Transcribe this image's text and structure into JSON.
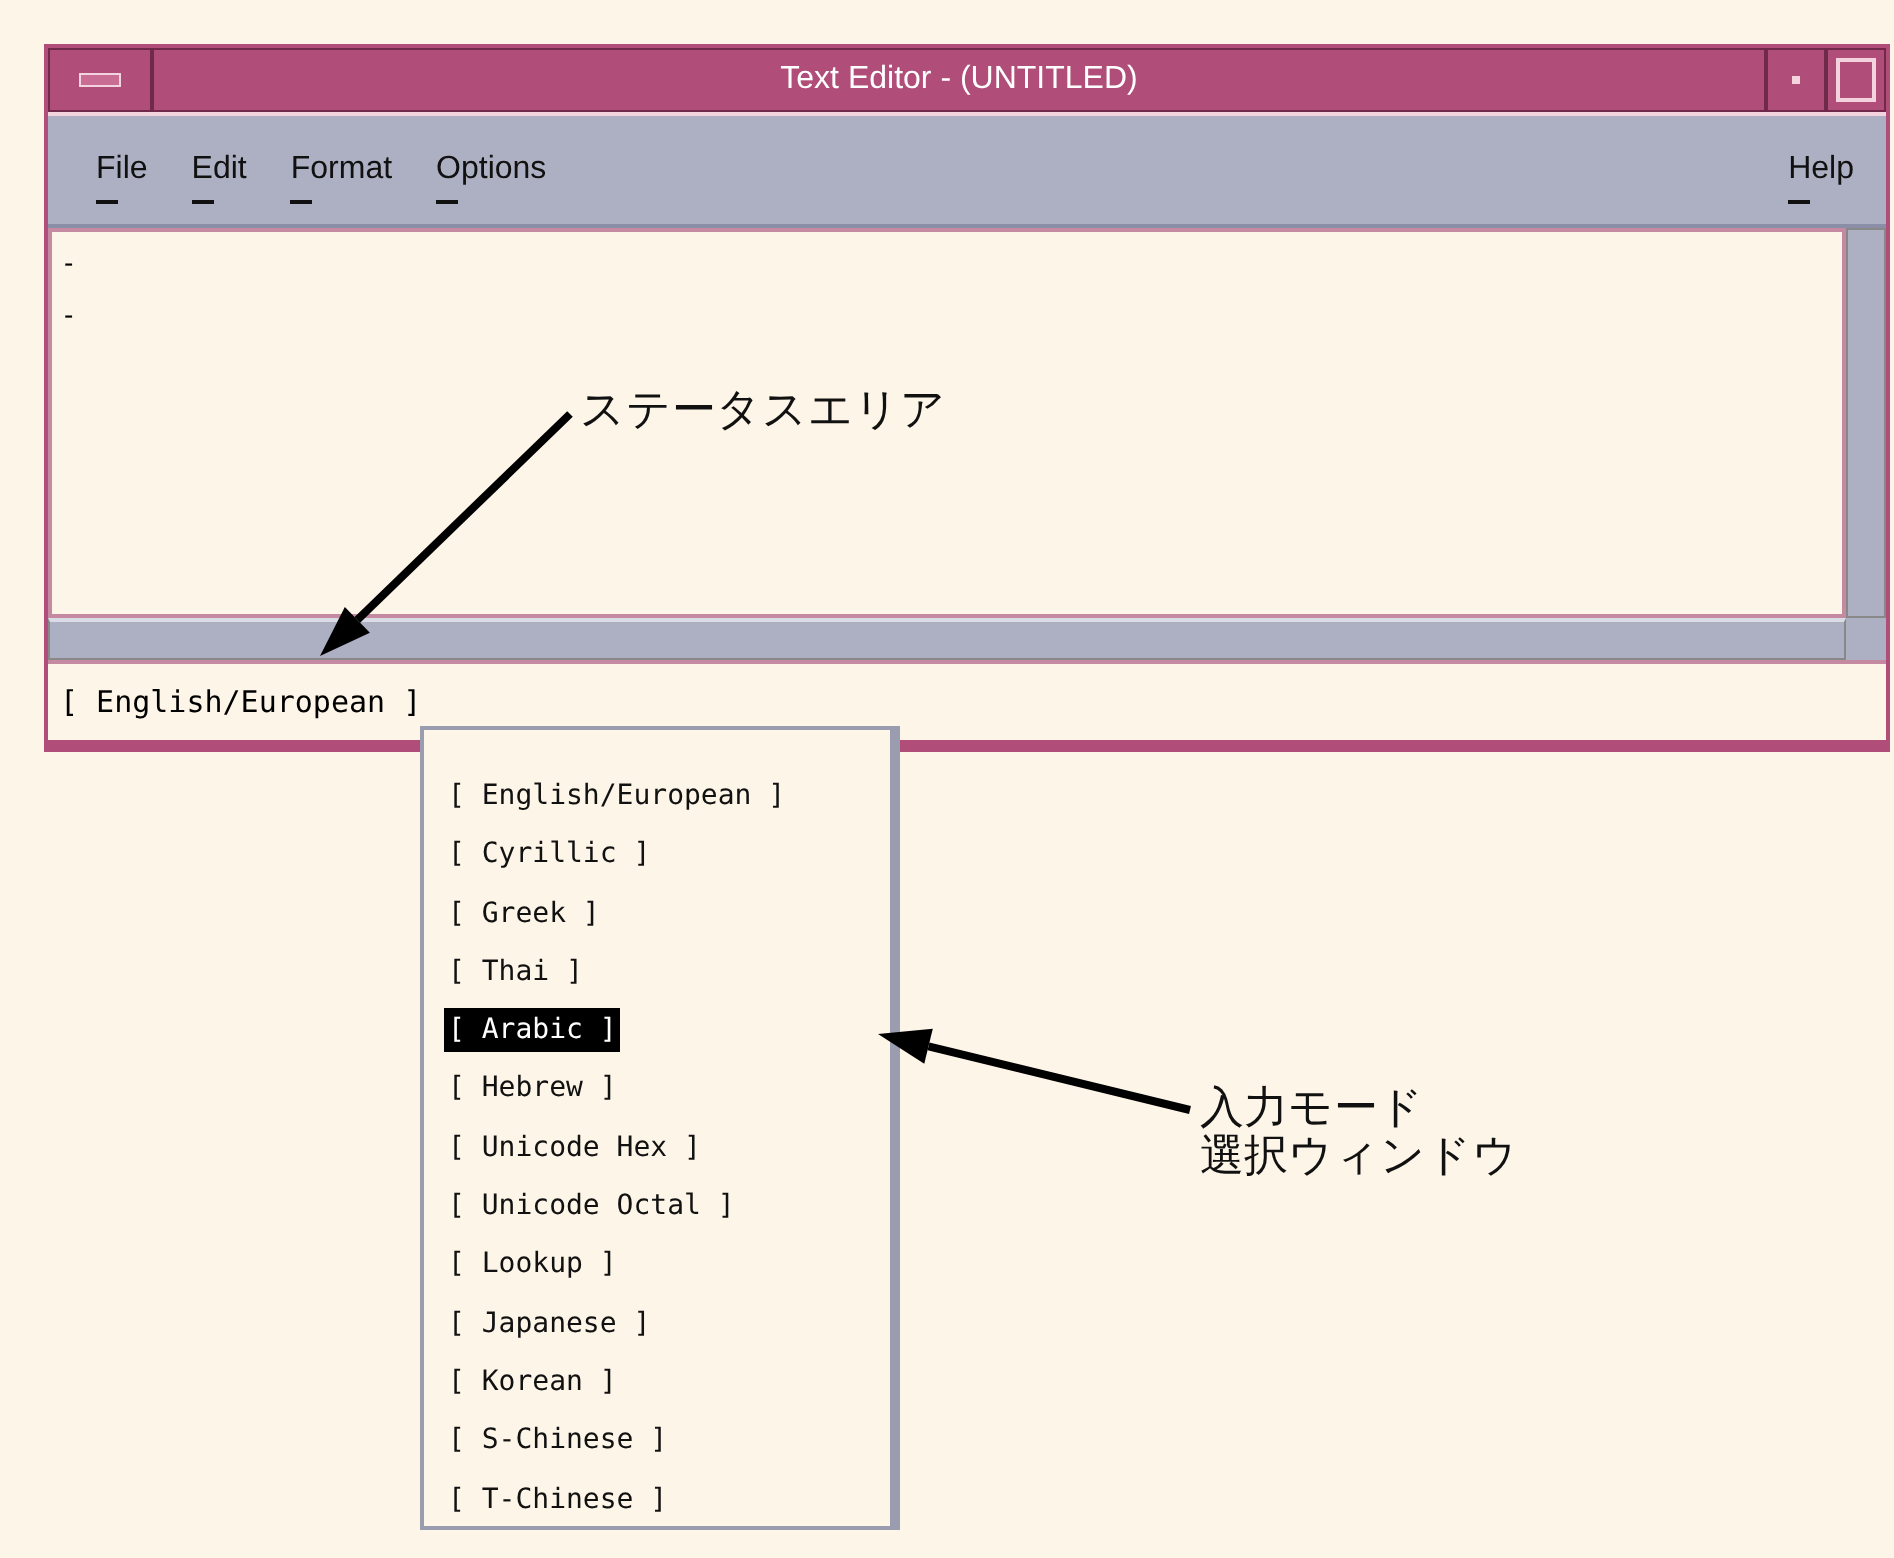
{
  "window": {
    "title": "Text Editor - (UNTITLED)"
  },
  "menu_bar": {
    "items": [
      "File",
      "Edit",
      "Format",
      "Options"
    ],
    "help": "Help"
  },
  "text_area": {
    "lines": [
      "-",
      "-"
    ]
  },
  "status_area": {
    "text": "[ English/European ]"
  },
  "input_mode_window": {
    "items": [
      {
        "label": "[ English/European ]",
        "selected": false
      },
      {
        "label": "[ Cyrillic ]",
        "selected": false
      },
      {
        "label": "[ Greek ]",
        "selected": false
      },
      {
        "label": "[ Thai ]",
        "selected": false
      },
      {
        "label": "[ Arabic ]",
        "selected": true
      },
      {
        "label": "[ Hebrew ]",
        "selected": false
      },
      {
        "label": "[ Unicode Hex ]",
        "selected": false
      },
      {
        "label": "[ Unicode Octal ]",
        "selected": false
      },
      {
        "label": "[ Lookup ]",
        "selected": false
      },
      {
        "label": "[ Japanese ]",
        "selected": false
      },
      {
        "label": "[ Korean ]",
        "selected": false
      },
      {
        "label": "[ S-Chinese ]",
        "selected": false
      },
      {
        "label": "[ T-Chinese ]",
        "selected": false
      }
    ]
  },
  "callouts": [
    {
      "lines": [
        "ステータスエリア"
      ]
    },
    {
      "lines": [
        "入力モード",
        "選択ウィンドウ"
      ]
    }
  ]
}
